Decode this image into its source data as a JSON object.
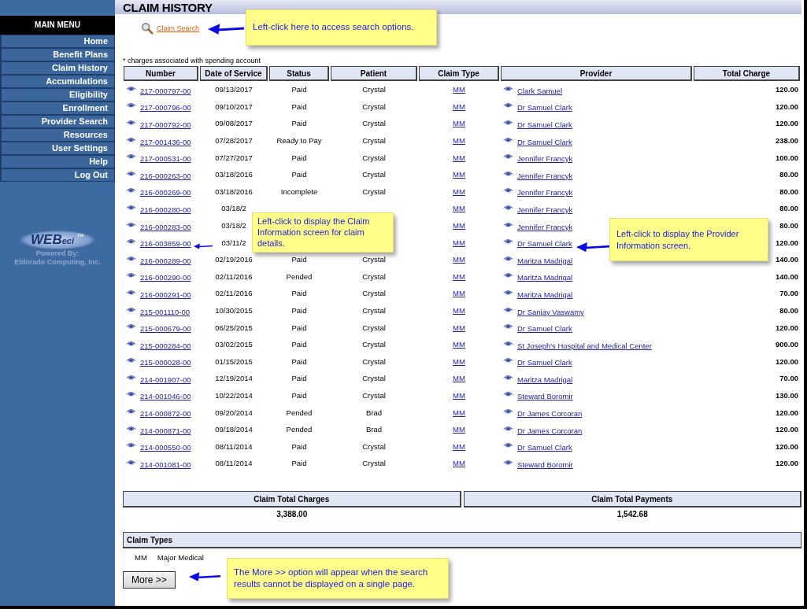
{
  "page_title": "CLAIM HISTORY",
  "sidebar": {
    "header": "MAIN MENU",
    "items": [
      {
        "label": "Home"
      },
      {
        "label": "Benefit Plans"
      },
      {
        "label": "Claim History"
      },
      {
        "label": "Accumulations"
      },
      {
        "label": "Eligibility"
      },
      {
        "label": "Enrollment"
      },
      {
        "label": "Provider Search"
      },
      {
        "label": "Resources"
      },
      {
        "label": "User Settings"
      },
      {
        "label": "Help"
      },
      {
        "label": "Log Out"
      }
    ],
    "logo": {
      "main": "WEB",
      "suffix": "eci",
      "mark": "™",
      "powered_by": "Powered By:",
      "company": "Eldorado Computing, Inc."
    }
  },
  "search_link": "Claim Search",
  "note": "* charges associated with spending account",
  "table": {
    "columns": [
      "Number",
      "Date of Service",
      "Status",
      "Patient",
      "Claim Type",
      "Provider",
      "Total Charge"
    ],
    "rows": [
      {
        "number": "217-000797-00",
        "date": "09/13/2017",
        "status": "Paid",
        "patient": "Crystal",
        "claim_type": "MM",
        "provider": "Clark Samuel",
        "total_charge": "120.00"
      },
      {
        "number": "217-000796-00",
        "date": "09/10/2017",
        "status": "Paid",
        "patient": "Crystal",
        "claim_type": "MM",
        "provider": "Dr Samuel Clark",
        "total_charge": "120.00"
      },
      {
        "number": "217-000792-00",
        "date": "09/08/2017",
        "status": "Paid",
        "patient": "Crystal",
        "claim_type": "MM",
        "provider": "Dr Samuel Clark",
        "total_charge": "120.00"
      },
      {
        "number": "217-001436-00",
        "date": "07/28/2017",
        "status": "Ready to Pay",
        "patient": "Crystal",
        "claim_type": "MM",
        "provider": "Dr Samuel Clark",
        "total_charge": "238.00"
      },
      {
        "number": "217-000531-00",
        "date": "07/27/2017",
        "status": "Paid",
        "patient": "Crystal",
        "claim_type": "MM",
        "provider": "Jennifer Francyk",
        "total_charge": "100.00"
      },
      {
        "number": "216-000263-00",
        "date": "03/18/2016",
        "status": "Paid",
        "patient": "Crystal",
        "claim_type": "MM",
        "provider": "Jennifer Francyk",
        "total_charge": "80.00"
      },
      {
        "number": "216-000269-00",
        "date": "03/18/2016",
        "status": "Incomplete",
        "patient": "Crystal",
        "claim_type": "MM",
        "provider": "Jennifer Francyk",
        "total_charge": "80.00"
      },
      {
        "number": "216-000280-00",
        "date": "03/18/2",
        "claim_type": "MM",
        "provider": "Jennifer Francyk",
        "total_charge": "80.00"
      },
      {
        "number": "216-000283-00",
        "date": "03/18/2",
        "claim_type": "MM",
        "provider": "Jennifer Francyk",
        "total_charge": "80.00"
      },
      {
        "number": "216-003859-00",
        "date": "03/11/2",
        "claim_type": "MM",
        "provider": "Dr Samuel Clark",
        "total_charge": "120.00"
      },
      {
        "number": "216-000289-00",
        "date": "02/19/2016",
        "status": "Paid",
        "patient": "Crystal",
        "claim_type": "MM",
        "provider": "Maritza Madrigal",
        "total_charge": "140.00"
      },
      {
        "number": "216-000290-00",
        "date": "02/11/2016",
        "status": "Pended",
        "patient": "Crystal",
        "claim_type": "MM",
        "provider": "Maritza Madrigal",
        "total_charge": "140.00"
      },
      {
        "number": "216-000291-00",
        "date": "02/11/2016",
        "status": "Paid",
        "patient": "Crystal",
        "claim_type": "MM",
        "provider": "Maritza Madrigal",
        "total_charge": "70.00"
      },
      {
        "number": "215-001110-00",
        "date": "10/30/2015",
        "status": "Paid",
        "patient": "Crystal",
        "claim_type": "MM",
        "provider": "Dr Sanjay Vaswamy",
        "total_charge": "80.00"
      },
      {
        "number": "215-000679-00",
        "date": "06/25/2015",
        "status": "Paid",
        "patient": "Crystal",
        "claim_type": "MM",
        "provider": "Dr Samuel Clark",
        "total_charge": "120.00"
      },
      {
        "number": "215-000284-00",
        "date": "03/02/2015",
        "status": "Paid",
        "patient": "Crystal",
        "claim_type": "MM",
        "provider": "St Joseph's Hospital and Medical Center",
        "total_charge": "900.00"
      },
      {
        "number": "215-000028-00",
        "date": "01/15/2015",
        "status": "Paid",
        "patient": "Crystal",
        "claim_type": "MM",
        "provider": "Dr Samuel Clark",
        "total_charge": "120.00"
      },
      {
        "number": "214-001907-00",
        "date": "12/19/2014",
        "status": "Paid",
        "patient": "Crystal",
        "claim_type": "MM",
        "provider": "Maritza Madrigal",
        "total_charge": "70.00"
      },
      {
        "number": "214-001046-00",
        "date": "10/22/2014",
        "status": "Paid",
        "patient": "Crystal",
        "claim_type": "MM",
        "provider": "Steward Boromir",
        "total_charge": "130.00"
      },
      {
        "number": "214-000872-00",
        "date": "09/20/2014",
        "status": "Pended",
        "patient": "Brad",
        "claim_type": "MM",
        "provider": "Dr James Corcoran",
        "total_charge": "120.00"
      },
      {
        "number": "214-000871-00",
        "date": "09/18/2014",
        "status": "Pended",
        "patient": "Brad",
        "claim_type": "MM",
        "provider": "Dr James Corcoran",
        "total_charge": "120.00"
      },
      {
        "number": "214-000550-00",
        "date": "08/11/2014",
        "status": "Paid",
        "patient": "Crystal",
        "claim_type": "MM",
        "provider": "Dr Samuel Clark",
        "total_charge": "120.00"
      },
      {
        "number": "214-001081-00",
        "date": "08/11/2014",
        "status": "Paid",
        "patient": "Crystal",
        "claim_type": "MM",
        "provider": "Steward Boromir",
        "total_charge": "120.00"
      }
    ]
  },
  "totals": [
    {
      "label": "Claim Total Charges",
      "value": "3,388.00"
    },
    {
      "label": "Claim Total Payments",
      "value": "1,542.68"
    }
  ],
  "claim_types": {
    "title": "Claim Types",
    "items": [
      {
        "code": "MM",
        "description": "Major Medical"
      }
    ]
  },
  "more_button": "More >>",
  "callouts": [
    {
      "text": "Left-click here to access search options."
    },
    {
      "text": "Left-click to display the Claim Information screen for claim details."
    },
    {
      "text": "Left-click to display the Provider Information screen."
    },
    {
      "text": "The More >> option will appear when the search results cannot be displayed on a single page."
    }
  ]
}
